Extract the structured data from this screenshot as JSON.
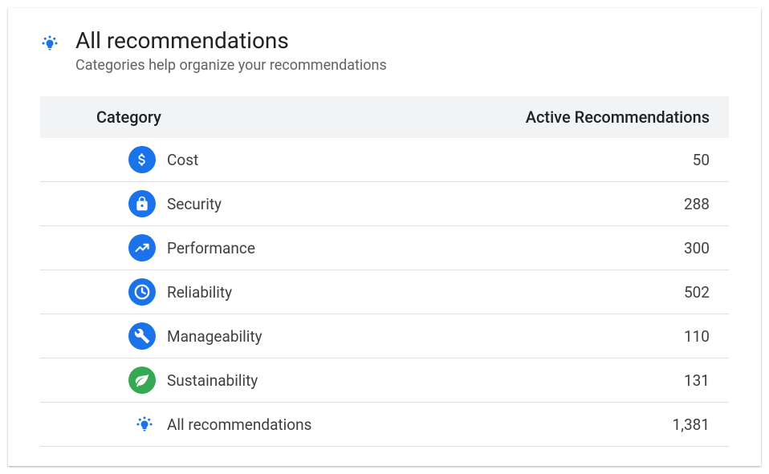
{
  "header": {
    "title": "All recommendations",
    "subtitle": "Categories help organize your recommendations"
  },
  "table": {
    "headers": {
      "category": "Category",
      "count": "Active Recommendations"
    },
    "rows": [
      {
        "icon": "cost",
        "label": "Cost",
        "count": "50"
      },
      {
        "icon": "security",
        "label": "Security",
        "count": "288"
      },
      {
        "icon": "performance",
        "label": "Performance",
        "count": "300"
      },
      {
        "icon": "reliability",
        "label": "Reliability",
        "count": "502"
      },
      {
        "icon": "manageability",
        "label": "Manageability",
        "count": "110"
      },
      {
        "icon": "sustainability",
        "label": "Sustainability",
        "count": "131"
      }
    ],
    "summary": {
      "label": "All recommendations",
      "count": "1,381"
    }
  }
}
